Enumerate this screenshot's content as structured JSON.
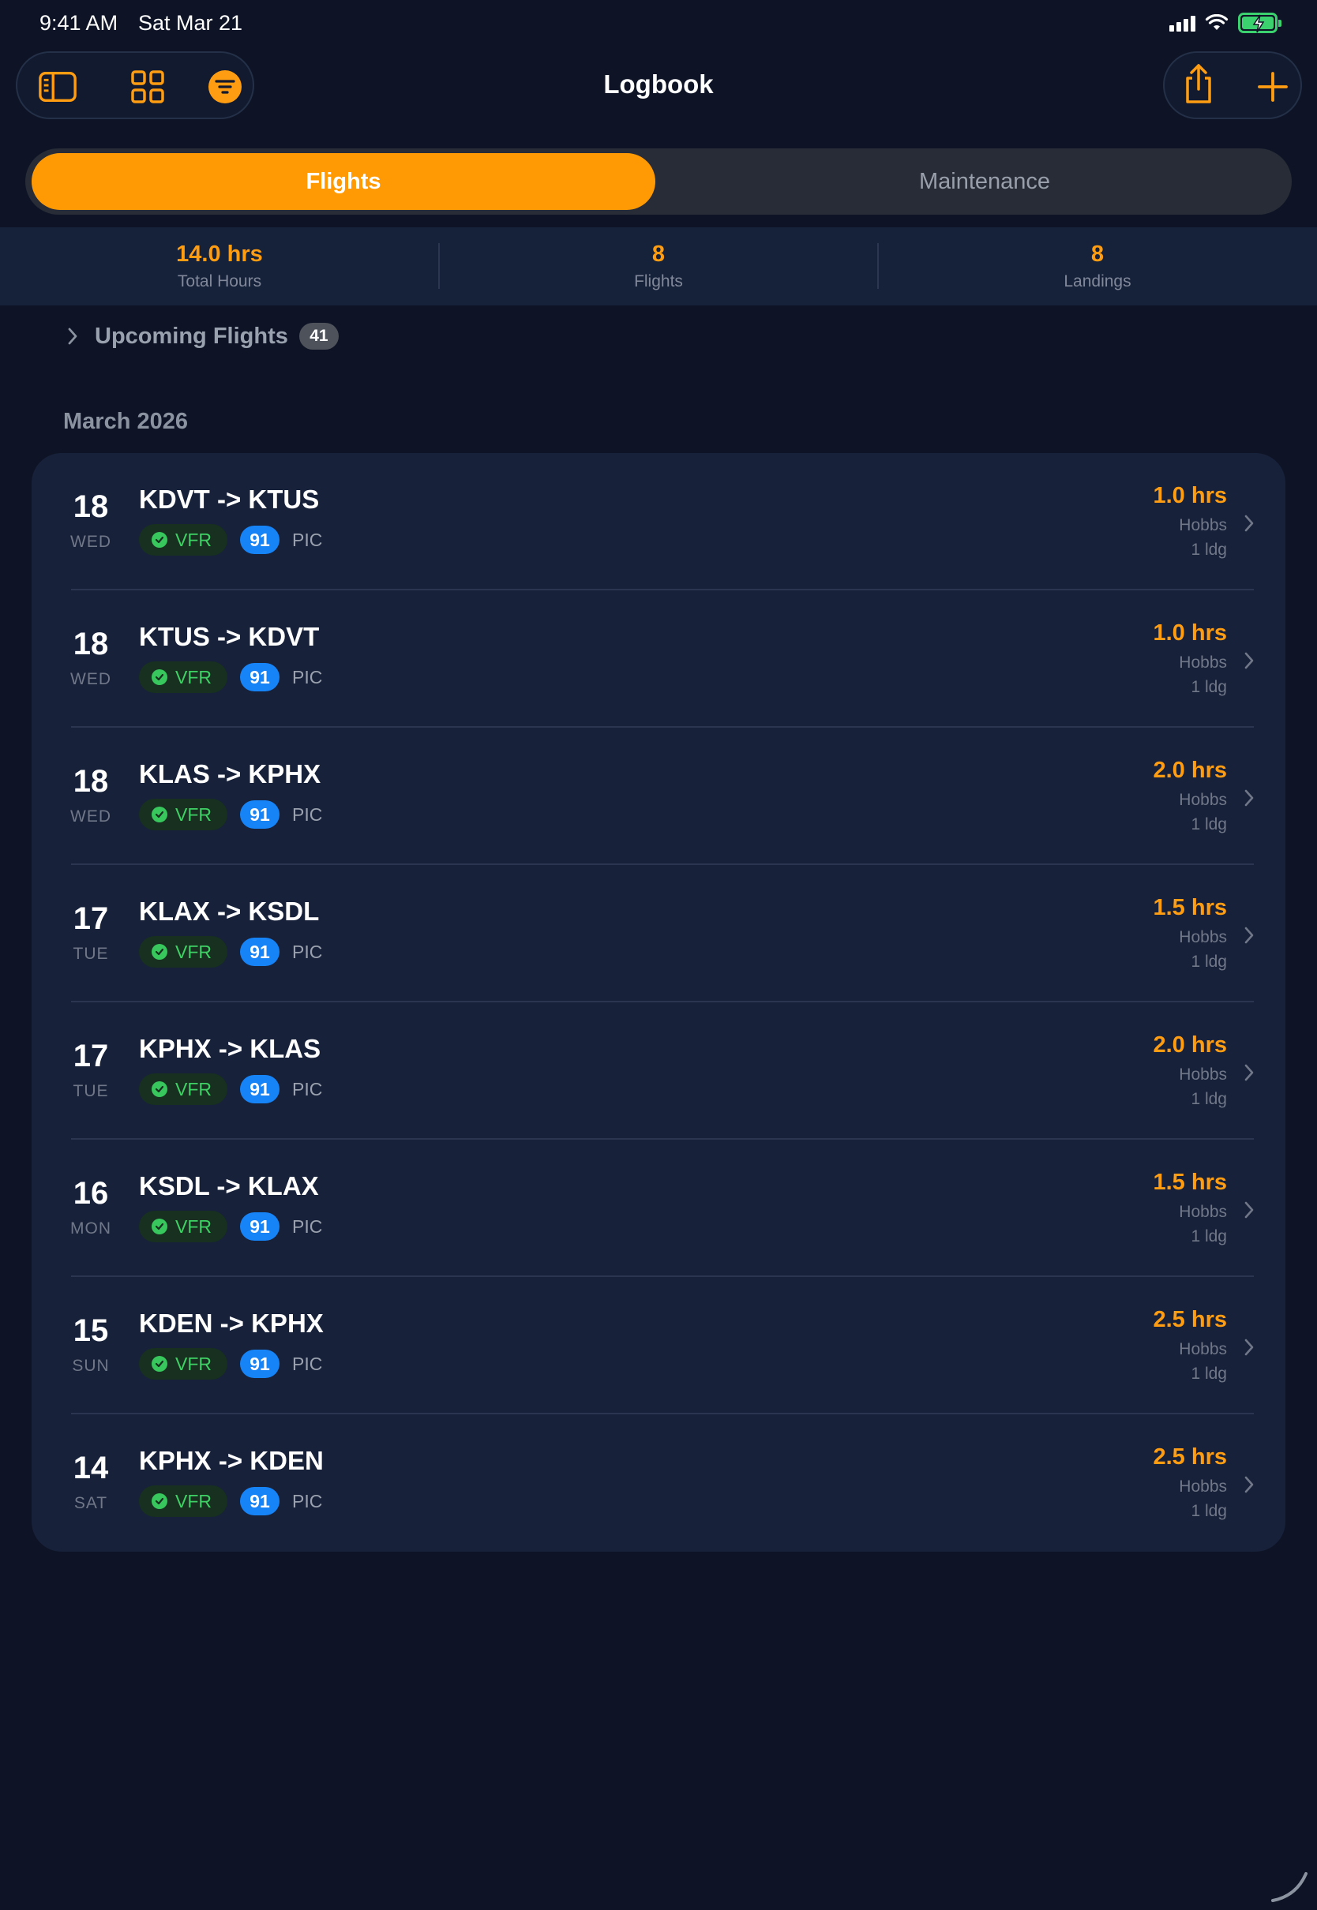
{
  "status_bar": {
    "time": "9:41 AM",
    "date": "Sat Mar 21"
  },
  "toolbar": {
    "title": "Logbook",
    "left_icons": [
      "sidebar-icon",
      "grid-icon",
      "filter-icon"
    ],
    "right_icons": [
      "share-icon",
      "plus-icon"
    ]
  },
  "segments": {
    "active": "Flights",
    "inactive": "Maintenance"
  },
  "stats": [
    {
      "value": "14.0 hrs",
      "label": "Total Hours"
    },
    {
      "value": "8",
      "label": "Flights"
    },
    {
      "value": "8",
      "label": "Landings"
    }
  ],
  "upcoming": {
    "label": "Upcoming Flights",
    "count": "41"
  },
  "month_header": "March 2026",
  "flights": [
    {
      "day": "18",
      "weekday": "WED",
      "route": "KDVT -> KTUS",
      "condition": "VFR",
      "rule": "91",
      "role": "PIC",
      "hours": "1.0 hrs",
      "hobbs": "Hobbs",
      "landings": "1 ldg"
    },
    {
      "day": "18",
      "weekday": "WED",
      "route": "KTUS -> KDVT",
      "condition": "VFR",
      "rule": "91",
      "role": "PIC",
      "hours": "1.0 hrs",
      "hobbs": "Hobbs",
      "landings": "1 ldg"
    },
    {
      "day": "18",
      "weekday": "WED",
      "route": "KLAS -> KPHX",
      "condition": "VFR",
      "rule": "91",
      "role": "PIC",
      "hours": "2.0 hrs",
      "hobbs": "Hobbs",
      "landings": "1 ldg"
    },
    {
      "day": "17",
      "weekday": "TUE",
      "route": "KLAX -> KSDL",
      "condition": "VFR",
      "rule": "91",
      "role": "PIC",
      "hours": "1.5 hrs",
      "hobbs": "Hobbs",
      "landings": "1 ldg"
    },
    {
      "day": "17",
      "weekday": "TUE",
      "route": "KPHX -> KLAS",
      "condition": "VFR",
      "rule": "91",
      "role": "PIC",
      "hours": "2.0 hrs",
      "hobbs": "Hobbs",
      "landings": "1 ldg"
    },
    {
      "day": "16",
      "weekday": "MON",
      "route": "KSDL -> KLAX",
      "condition": "VFR",
      "rule": "91",
      "role": "PIC",
      "hours": "1.5 hrs",
      "hobbs": "Hobbs",
      "landings": "1 ldg"
    },
    {
      "day": "15",
      "weekday": "SUN",
      "route": "KDEN -> KPHX",
      "condition": "VFR",
      "rule": "91",
      "role": "PIC",
      "hours": "2.5 hrs",
      "hobbs": "Hobbs",
      "landings": "1 ldg"
    },
    {
      "day": "14",
      "weekday": "SAT",
      "route": "KPHX -> KDEN",
      "condition": "VFR",
      "rule": "91",
      "role": "PIC",
      "hours": "2.5 hrs",
      "hobbs": "Hobbs",
      "landings": "1 ldg"
    }
  ],
  "colors": {
    "accent": "#ff9a05",
    "background": "#0e1426",
    "card": "#17213a",
    "vfr_green": "#3fd165",
    "rule_blue": "#1683f7"
  }
}
